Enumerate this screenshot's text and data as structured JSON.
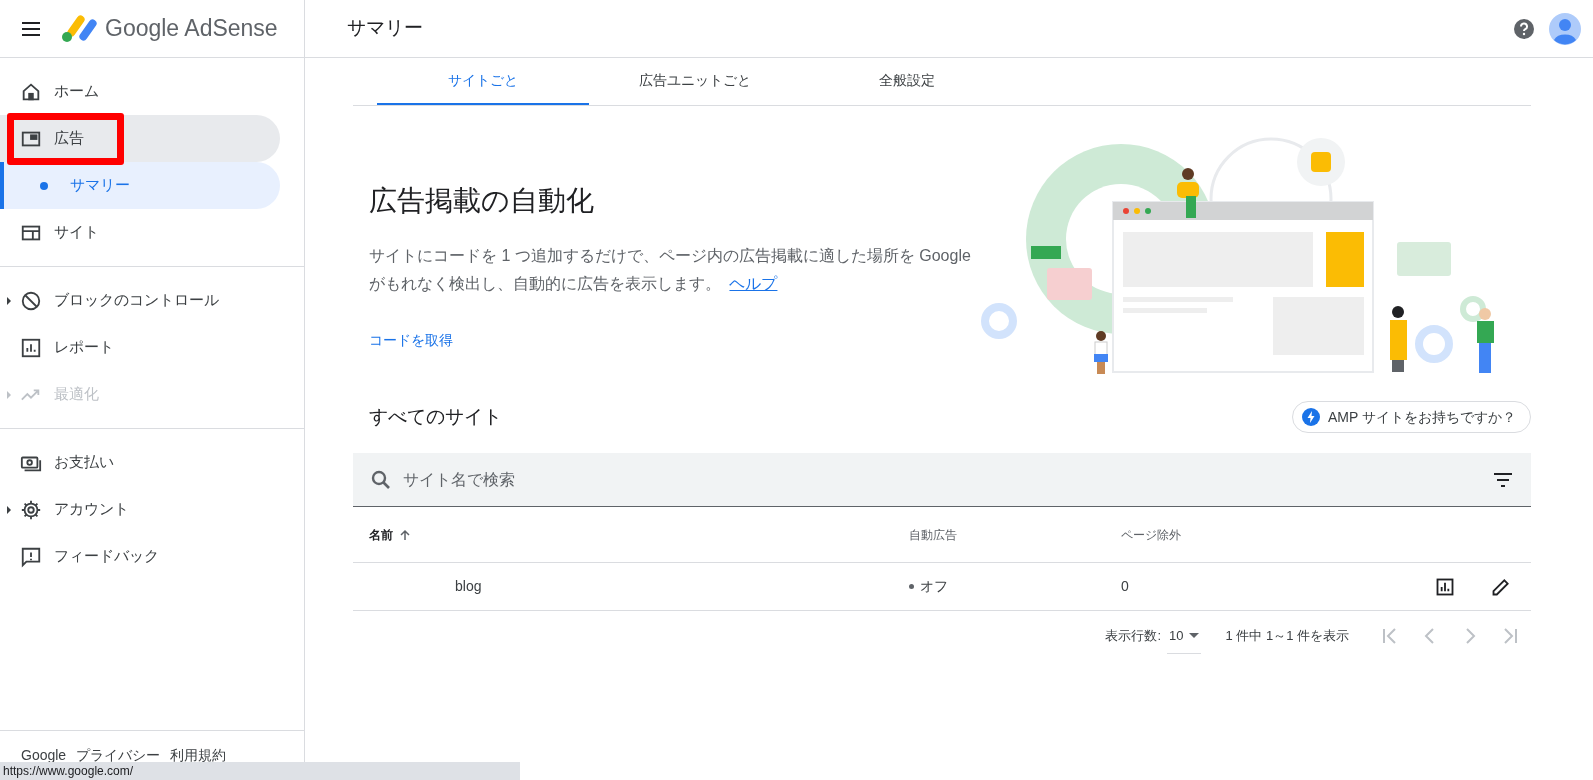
{
  "header": {
    "product": "Google AdSense",
    "page_title": "サマリー"
  },
  "sidebar": {
    "sections": [
      [
        {
          "label": "ホーム",
          "expandable": false,
          "disabled": false,
          "selected": false,
          "highlighted": false
        },
        {
          "label": "広告",
          "expandable": false,
          "disabled": false,
          "selected": true,
          "highlighted": true,
          "children": [
            {
              "label": "サマリー",
              "selected": true
            }
          ]
        },
        {
          "label": "サイト",
          "expandable": false,
          "disabled": false,
          "selected": false,
          "highlighted": false
        }
      ],
      [
        {
          "label": "ブロックのコントロール",
          "expandable": true,
          "disabled": false,
          "selected": false,
          "highlighted": false
        },
        {
          "label": "レポート",
          "expandable": false,
          "disabled": false,
          "selected": false,
          "highlighted": false
        },
        {
          "label": "最適化",
          "expandable": true,
          "disabled": true,
          "selected": false,
          "highlighted": false
        }
      ],
      [
        {
          "label": "お支払い",
          "expandable": false,
          "disabled": false,
          "selected": false,
          "highlighted": false
        },
        {
          "label": "アカウント",
          "expandable": true,
          "disabled": false,
          "selected": false,
          "highlighted": false
        },
        {
          "label": "フィードバック",
          "expandable": false,
          "disabled": false,
          "selected": false,
          "highlighted": false
        }
      ]
    ],
    "footer_links": [
      "Google",
      "プライバシー",
      "利用規約"
    ]
  },
  "tabs": [
    {
      "label": "サイトごと",
      "selected": true
    },
    {
      "label": "広告ユニットごと",
      "selected": false
    },
    {
      "label": "全般設定",
      "selected": false
    }
  ],
  "hero": {
    "title": "広告掲載の自動化",
    "text": "サイトにコードを 1 つ追加するだけで、ページ内の広告掲載に適した場所を Google がもれなく検出し、自動的に広告を表示します。",
    "link": "ヘルプ",
    "button": "コードを取得"
  },
  "sites": {
    "title": "すべてのサイト",
    "amp_chip": "AMP サイトをお持ちですか？",
    "search": {
      "placeholder": "サイト名で検索"
    },
    "columns": [
      {
        "label": "名前",
        "sorted": true
      },
      {
        "label": "自動広告",
        "sorted": false
      },
      {
        "label": "ページ除外",
        "sorted": false
      }
    ],
    "rows": [
      {
        "name": "blog",
        "auto_ads": "オフ",
        "color": "#5f6368",
        "excluded": "0"
      }
    ],
    "pagination": {
      "rows_label": "表示行数:",
      "rows_value": "10",
      "range": "1 件中 1～1 件を表示"
    }
  },
  "status_url": "https://www.google.com/"
}
